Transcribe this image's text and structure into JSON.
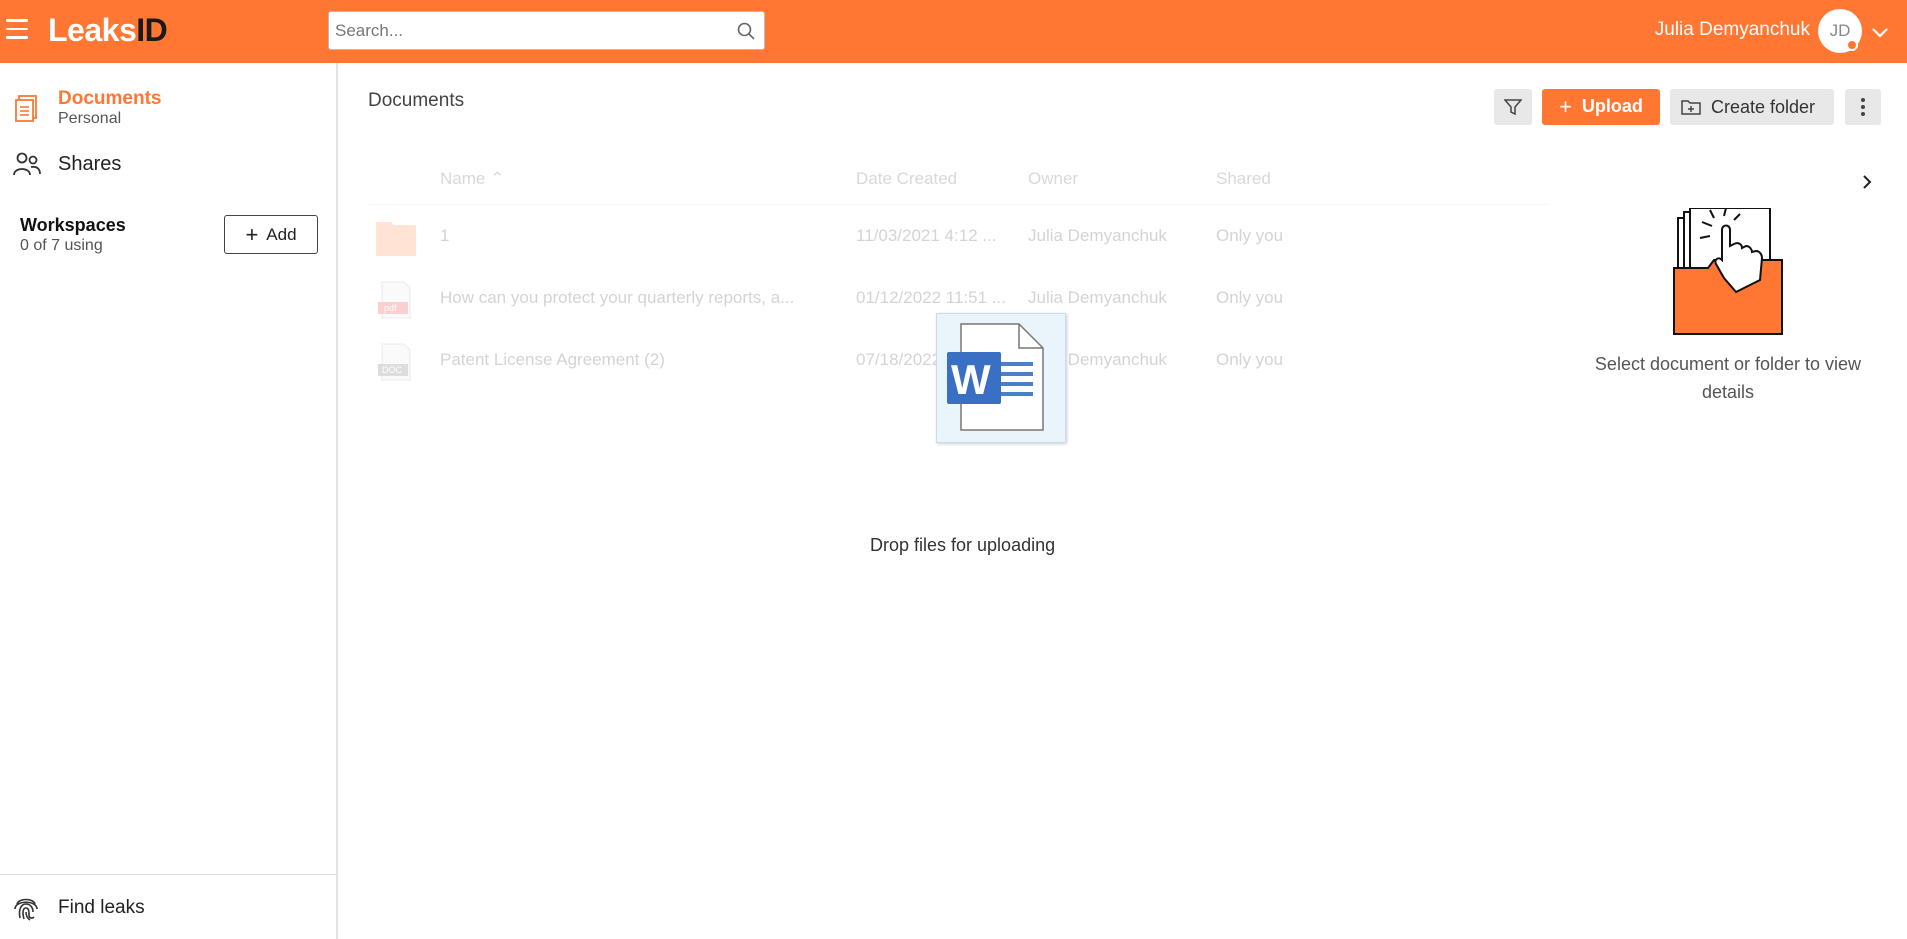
{
  "app": {
    "logo_part1": "Leaks",
    "logo_part2": "ID",
    "brand_color": "#ff7733"
  },
  "header": {
    "search_placeholder": "Search...",
    "user_name": "Julia Demyanchuk",
    "user_initials": "JD"
  },
  "sidebar": {
    "documents_label": "Documents",
    "documents_sub": "Personal",
    "shares_label": "Shares",
    "workspaces_title": "Workspaces",
    "workspaces_usage": "0 of 7 using",
    "add_label": "Add",
    "find_leaks_label": "Find leaks"
  },
  "main": {
    "title": "Documents",
    "upload_label": "Upload",
    "create_folder_label": "Create folder",
    "columns": {
      "name": "Name",
      "date_created": "Date Created",
      "owner": "Owner",
      "shared": "Shared"
    },
    "rows": [
      {
        "type": "folder",
        "name": "1",
        "date": "11/03/2021 4:12 ...",
        "owner": "Julia Demyanchuk",
        "shared": "Only you"
      },
      {
        "type": "pdf",
        "name": "How can you protect your quarterly reports, a...",
        "date": "01/12/2022 11:51 ...",
        "owner": "Julia Demyanchuk",
        "shared": "Only you"
      },
      {
        "type": "doc",
        "name": "Patent License Agreement (2)",
        "date": "07/18/2022 ...",
        "owner": "Julia Demyanchuk",
        "shared": "Only you"
      }
    ],
    "drop_text": "Drop files for uploading"
  },
  "panel": {
    "empty_text": "Select document or folder to view details"
  }
}
